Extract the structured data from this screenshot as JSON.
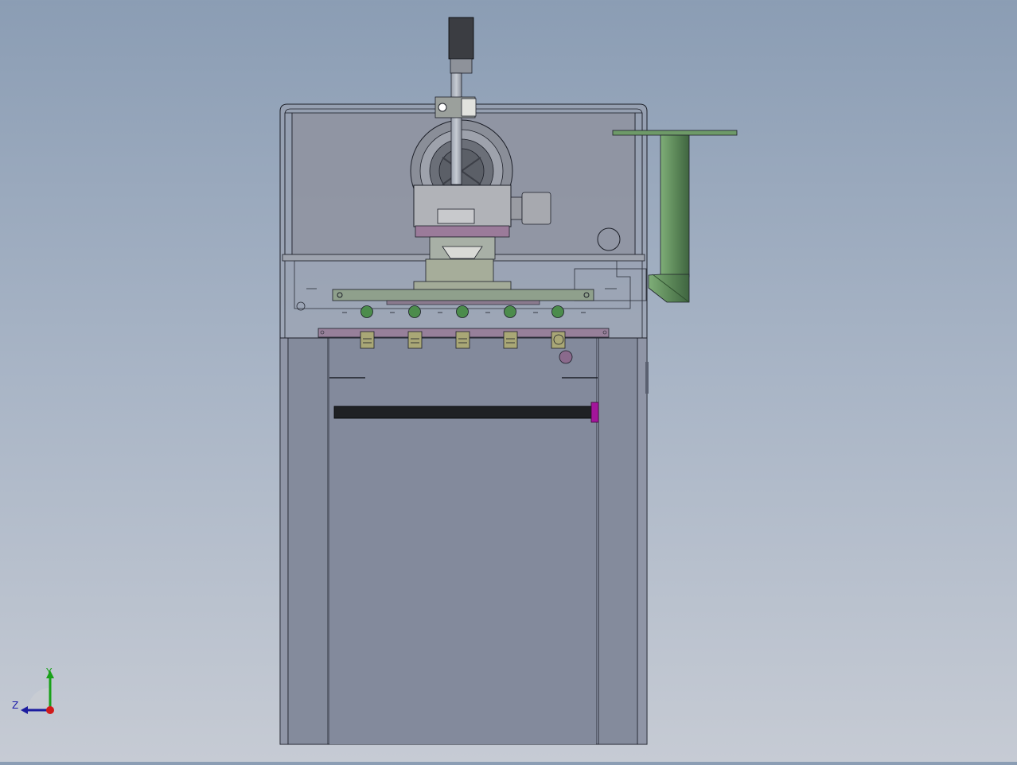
{
  "view": {
    "background_top": "#8b9db4",
    "background_bottom": "#c6cbd4",
    "model_body_color": "#838a9c",
    "model_edge_color": "#1c1f28",
    "accent_green": "#5e8a5a",
    "accent_magenta": "#a3159b"
  },
  "triad": {
    "y_label": "Y",
    "z_label": "Z",
    "x_color": "#d11a1a",
    "y_color": "#19a119",
    "z_color": "#1c1caa"
  },
  "icons": [
    "coordinate-triad-icon"
  ]
}
